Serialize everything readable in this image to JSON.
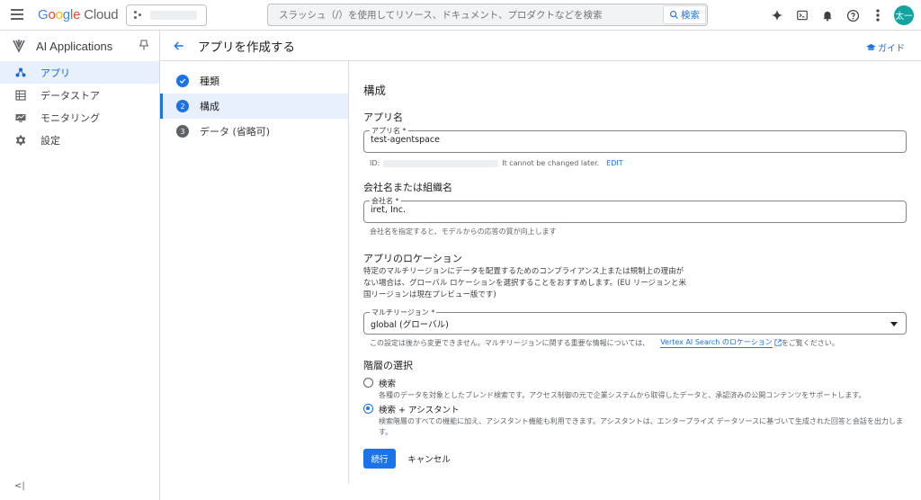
{
  "topbar": {
    "logo": {
      "g": "G",
      "o1": "o",
      "o2": "o",
      "g2": "g",
      "l": "l",
      "e": "e",
      "cloud": " Cloud"
    },
    "search_placeholder": "スラッシュ（/）を使用してリソース、ドキュメント、プロダクトなどを検索",
    "search_button": "検索",
    "avatar_initials": "太一",
    "icons": [
      "gemini-icon",
      "cloud-shell-icon",
      "notifications-icon",
      "help-icon",
      "more-vert-icon"
    ]
  },
  "sidebar": {
    "product_title": "AI Applications",
    "items": [
      {
        "label": "アプリ",
        "icon": "apps-icon",
        "active": true
      },
      {
        "label": "データストア",
        "icon": "data-store-icon",
        "active": false
      },
      {
        "label": "モニタリング",
        "icon": "monitoring-icon",
        "active": false
      },
      {
        "label": "設定",
        "icon": "settings-icon",
        "active": false
      }
    ],
    "collapse_glyph": "<|"
  },
  "page": {
    "title": "アプリを作成する",
    "guide_label": "ガイド"
  },
  "stepper": {
    "steps": [
      {
        "num": "✓",
        "label": "種類",
        "state": "done"
      },
      {
        "num": "2",
        "label": "構成",
        "state": "current"
      },
      {
        "num": "3",
        "label": "データ (省略可)",
        "state": "pending"
      }
    ]
  },
  "form": {
    "heading": "構成",
    "app_name_section": "アプリ名",
    "app_name_label": "アプリ名 *",
    "app_name_value": "test-agentspace",
    "id_prefix": "ID:",
    "id_note": "It cannot be changed later.",
    "id_edit": "EDIT",
    "company_section": "会社名または組織名",
    "company_label": "会社名 *",
    "company_value": "iret, Inc.",
    "company_hint": "会社名を指定すると、モデルからの応答の質が向上します",
    "location_section": "アプリのロケーション",
    "location_desc": "特定のマルチリージョンにデータを配置するためのコンプライアンス上または規制上の理由がない場合は、グローバル ロケーションを選択することをおすすめします。(EU リージョンと米国リージョンは現在プレビュー版です)",
    "multiregion_label": "マルチリージョン *",
    "multiregion_value": "global (グローバル)",
    "location_hint": "この設定は後から変更できません。マルチリージョンに関する重要な情報については、",
    "location_link": "Vertex AI Search のロケーション",
    "location_hint_after": "をご覧ください。",
    "tier_section": "階層の選択",
    "tiers": [
      {
        "label": "検索",
        "desc": "各種のデータを対象としたブレンド検索です。アクセス制御の元で企業システムから取得したデータと、承認済みの公開コンテンツをサポートします。",
        "checked": false
      },
      {
        "label": "検索 + アシスタント",
        "desc": "検索階層のすべての機能に加え、アシスタント機能も利用できます。アシスタントは、エンタープライズ データソースに基づいて生成された回答と会話を出力します。",
        "checked": true
      }
    ],
    "continue_button": "続行",
    "cancel_button": "キャンセル"
  }
}
